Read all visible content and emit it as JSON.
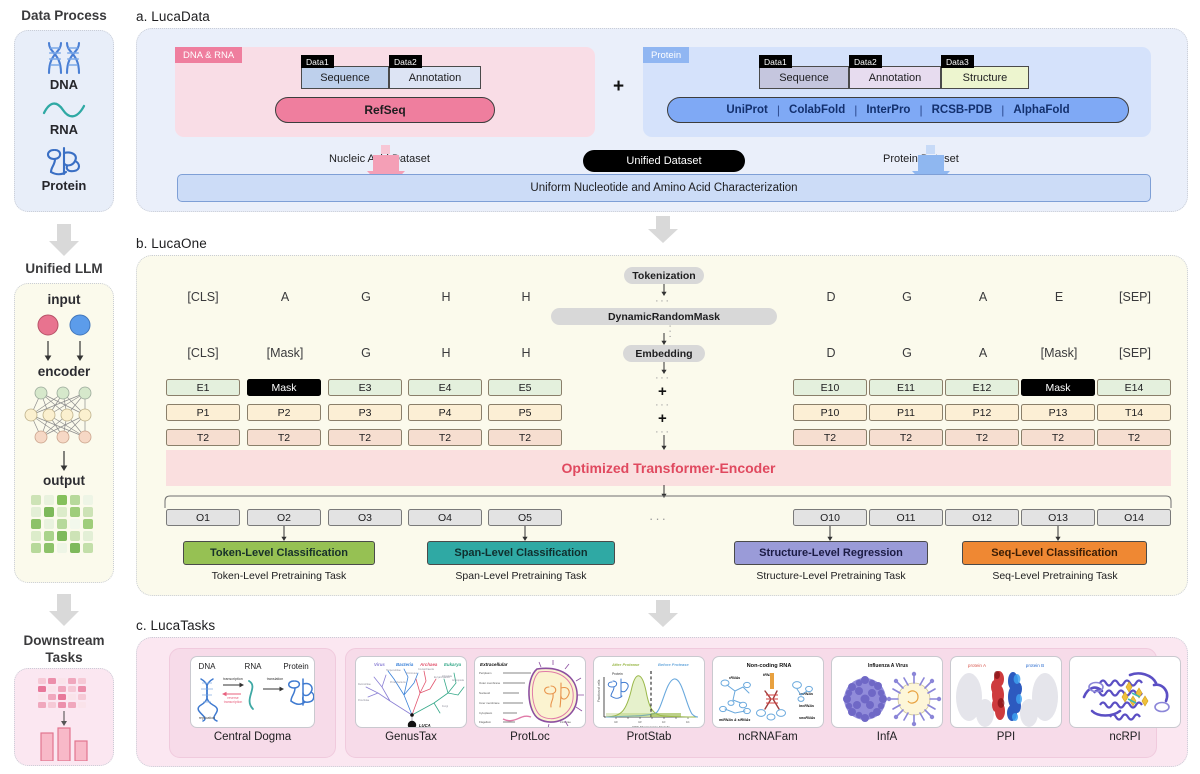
{
  "rail": {
    "sections": [
      {
        "title": "Data Process",
        "items": [
          {
            "icon": "dna-helix-icon",
            "label": "DNA"
          },
          {
            "icon": "rna-strand-icon",
            "label": "RNA"
          },
          {
            "icon": "protein-fold-icon",
            "label": "Protein"
          }
        ]
      },
      {
        "title": "Unified LLM",
        "input_label": "input",
        "encoder_label": "encoder",
        "output_label": "output"
      },
      {
        "title": "Downstream\nTasks",
        "title_line1": "Downstream",
        "title_line2": "Tasks"
      }
    ]
  },
  "panel_a": {
    "label": "a. LucaData",
    "nucleic": {
      "badge": "DNA & RNA",
      "tags": [
        "Data1",
        "Data2"
      ],
      "cells": [
        "Sequence",
        "Annotation"
      ],
      "database": "RefSeq"
    },
    "plus": "+",
    "protein": {
      "badge": "Protein",
      "tags": [
        "Data1",
        "Data2",
        "Data3"
      ],
      "cells": [
        "Sequence",
        "Annotation",
        "Structure"
      ],
      "databases": [
        "UniProt",
        "ColabFold",
        "InterPro",
        "RCSB-PDB",
        "AlphaFold"
      ],
      "separator": "|"
    },
    "nucleic_caption": "Nucleic Acid Dataset",
    "protein_caption": "Protein Dataset",
    "unified_label": "Unified Dataset",
    "unified_bar": "Uniform Nucleotide and Amino Acid  Characterization",
    "colors": {
      "nucleic_accent": "#ef7e9e",
      "protein_accent": "#7fa9f5",
      "panel_bg": "#eaeffa"
    }
  },
  "panel_b": {
    "label": "b. LucaOne",
    "stages": [
      "Tokenization",
      "DynamicRandomMask",
      "Embedding"
    ],
    "row_raw_left": [
      "[CLS]",
      "A",
      "G",
      "H",
      "H"
    ],
    "row_raw_right": [
      "D",
      "G",
      "A",
      "E",
      "[SEP]"
    ],
    "row_masked_left": [
      "[CLS]",
      "[Mask]",
      "G",
      "H",
      "H"
    ],
    "row_masked_right": [
      "D",
      "G",
      "A",
      "[Mask]",
      "[SEP]"
    ],
    "embeddings_left": [
      "E1",
      "Mask",
      "E3",
      "E4",
      "E5"
    ],
    "embeddings_right": [
      "E10",
      "E11",
      "E12",
      "Mask",
      "E14"
    ],
    "positions_left": [
      "P1",
      "P2",
      "P3",
      "P4",
      "P5"
    ],
    "positions_right": [
      "P10",
      "P11",
      "P12",
      "P13",
      "T14"
    ],
    "types_left": [
      "T2",
      "T2",
      "T2",
      "T2",
      "T2"
    ],
    "types_right": [
      "T2",
      "T2",
      "T2",
      "T2",
      "T2"
    ],
    "encoder": "Optimized Transformer-Encoder",
    "outputs_left": [
      "O1",
      "O2",
      "O3",
      "O4",
      "O5"
    ],
    "outputs_right": [
      "O10",
      "O11",
      "O12",
      "O13",
      "O14"
    ],
    "ellipsis": "···",
    "plus": "+",
    "tasks": [
      {
        "box": "Token-Level Classification",
        "caption": "Token-Level Pretraining Task",
        "color": "#96c153"
      },
      {
        "box": "Span-Level Classification",
        "caption": "Span-Level Pretraining Task",
        "color": "#2fa9a4"
      },
      {
        "box": "Structure-Level Regression",
        "caption": "Structure-Level Pretraining Task",
        "color": "#9a9bd8"
      },
      {
        "box": "Seq-Level Classification",
        "caption": "Seq-Level Pretraining Task",
        "color": "#ef8833"
      }
    ]
  },
  "panel_c": {
    "label": "c. LucaTasks",
    "group1": [
      {
        "caption": "Central Dogma",
        "thumb": "central-dogma-thumb",
        "labels": [
          "DNA",
          "RNA",
          "Protein",
          "transcription",
          "translation",
          "reverse transcription",
          "replication"
        ]
      }
    ],
    "group2": [
      {
        "caption": "GenusTax",
        "thumb": "genustax-thumb",
        "labels": [
          "Virus",
          "Bacteria",
          "Archaea",
          "Eukarya",
          "LUCA"
        ]
      },
      {
        "caption": "ProtLoc",
        "thumb": "protloc-thumb",
        "labels": [
          "Extracellular",
          "Periplasm",
          "Outer membrane",
          "Nucleoid",
          "Inner membrane",
          "Cytoplasm",
          "Flagellum"
        ]
      },
      {
        "caption": "ProtStab",
        "thumb": "protstab-thumb",
        "labels": [
          "After Protease",
          "Before Protease",
          "Protein",
          "Fraction of cells",
          "FITC Fluorescence Intensity"
        ]
      },
      {
        "caption": "ncRNAFam",
        "thumb": "ncrnafam-thumb",
        "labels": [
          "Non-coding RNA",
          "rRNAs",
          "tRNAs",
          "snRNAs",
          "lncRNAs",
          "miRNAs & siRNAs",
          "snoRNAs"
        ]
      },
      {
        "caption": "InfA",
        "thumb": "infa-thumb",
        "labels": [
          "Influenza A Virus"
        ]
      },
      {
        "caption": "PPI",
        "thumb": "ppi-thumb",
        "labels": [
          "protein A",
          "protein B"
        ]
      },
      {
        "caption": "ncRPI",
        "thumb": "ncrpi-thumb",
        "labels": []
      }
    ]
  }
}
